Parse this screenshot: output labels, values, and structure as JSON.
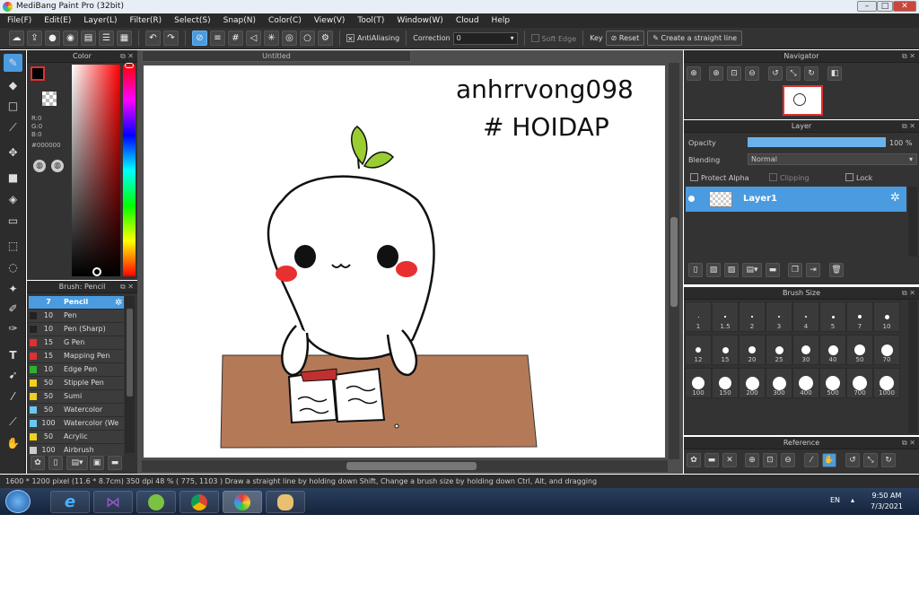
{
  "window": {
    "title": "MediBang Paint Pro (32bit)"
  },
  "menu": [
    "File(F)",
    "Edit(E)",
    "Layer(L)",
    "Filter(R)",
    "Select(S)",
    "Snap(N)",
    "Color(C)",
    "View(V)",
    "Tool(T)",
    "Window(W)",
    "Cloud",
    "Help"
  ],
  "toolbar": {
    "antialiasing_label": "AntiAliasing",
    "correction_label": "Correction",
    "correction_value": "0",
    "soft_edge_label": "Soft Edge",
    "key_label": "Key",
    "reset_label": "Reset",
    "straight_line_label": "Create a straight line"
  },
  "color_panel": {
    "title": "Color",
    "r": "R:0",
    "g": "G:0",
    "b": "B:0",
    "hex": "#000000",
    "primary_color": "#000000",
    "accent": "#4a9be0"
  },
  "canvas": {
    "tab_title": "Untitled"
  },
  "brush_panel": {
    "title": "Brush: Pencil",
    "items": [
      {
        "size": "7",
        "name": "Pencil",
        "color": "#4a9be0"
      },
      {
        "size": "10",
        "name": "Pen",
        "color": "#222222"
      },
      {
        "size": "10",
        "name": "Pen (Sharp)",
        "color": "#222222"
      },
      {
        "size": "15",
        "name": "G Pen",
        "color": "#e03030"
      },
      {
        "size": "15",
        "name": "Mapping Pen",
        "color": "#e03030"
      },
      {
        "size": "10",
        "name": "Edge Pen",
        "color": "#30b030"
      },
      {
        "size": "50",
        "name": "Stipple Pen",
        "color": "#f0d020"
      },
      {
        "size": "50",
        "name": "Sumi",
        "color": "#f0d020"
      },
      {
        "size": "50",
        "name": "Watercolor",
        "color": "#6ac8f0"
      },
      {
        "size": "100",
        "name": "Watercolor (We",
        "color": "#6ac8f0"
      },
      {
        "size": "50",
        "name": "Acrylic",
        "color": "#f0d020"
      },
      {
        "size": "100",
        "name": "Airbrush",
        "color": "#cccccc"
      }
    ]
  },
  "navigator": {
    "title": "Navigator"
  },
  "layer_panel": {
    "title": "Layer",
    "opacity_label": "Opacity",
    "opacity_value": "100 %",
    "opacity_fraction": 1.0,
    "blending_label": "Blending",
    "blending_value": "Normal",
    "protect_alpha_label": "Protect Alpha",
    "clipping_label": "Clipping",
    "lock_label": "Lock",
    "layer_name": "Layer1"
  },
  "brush_size": {
    "title": "Brush Size",
    "sizes": [
      "1",
      "1.5",
      "2",
      "3",
      "4",
      "5",
      "7",
      "10",
      "12",
      "15",
      "20",
      "25",
      "30",
      "40",
      "50",
      "70",
      "100",
      "150",
      "200",
      "300",
      "400",
      "500",
      "700",
      "1000"
    ]
  },
  "reference": {
    "title": "Reference"
  },
  "status": {
    "info": "1600 * 1200 pixel   (11.6 * 8.7cm)   350 dpi   48 %   ( 775, 1103 )   Draw a straight line by holding down Shift, Change a brush size by holding down Ctrl, Alt, and dragging"
  },
  "handwriting": {
    "line1": "anhrrvong098",
    "line2": "# HOIDAP"
  },
  "taskbar": {
    "lang": "EN",
    "time": "9:50 AM",
    "date": "7/3/2021"
  }
}
